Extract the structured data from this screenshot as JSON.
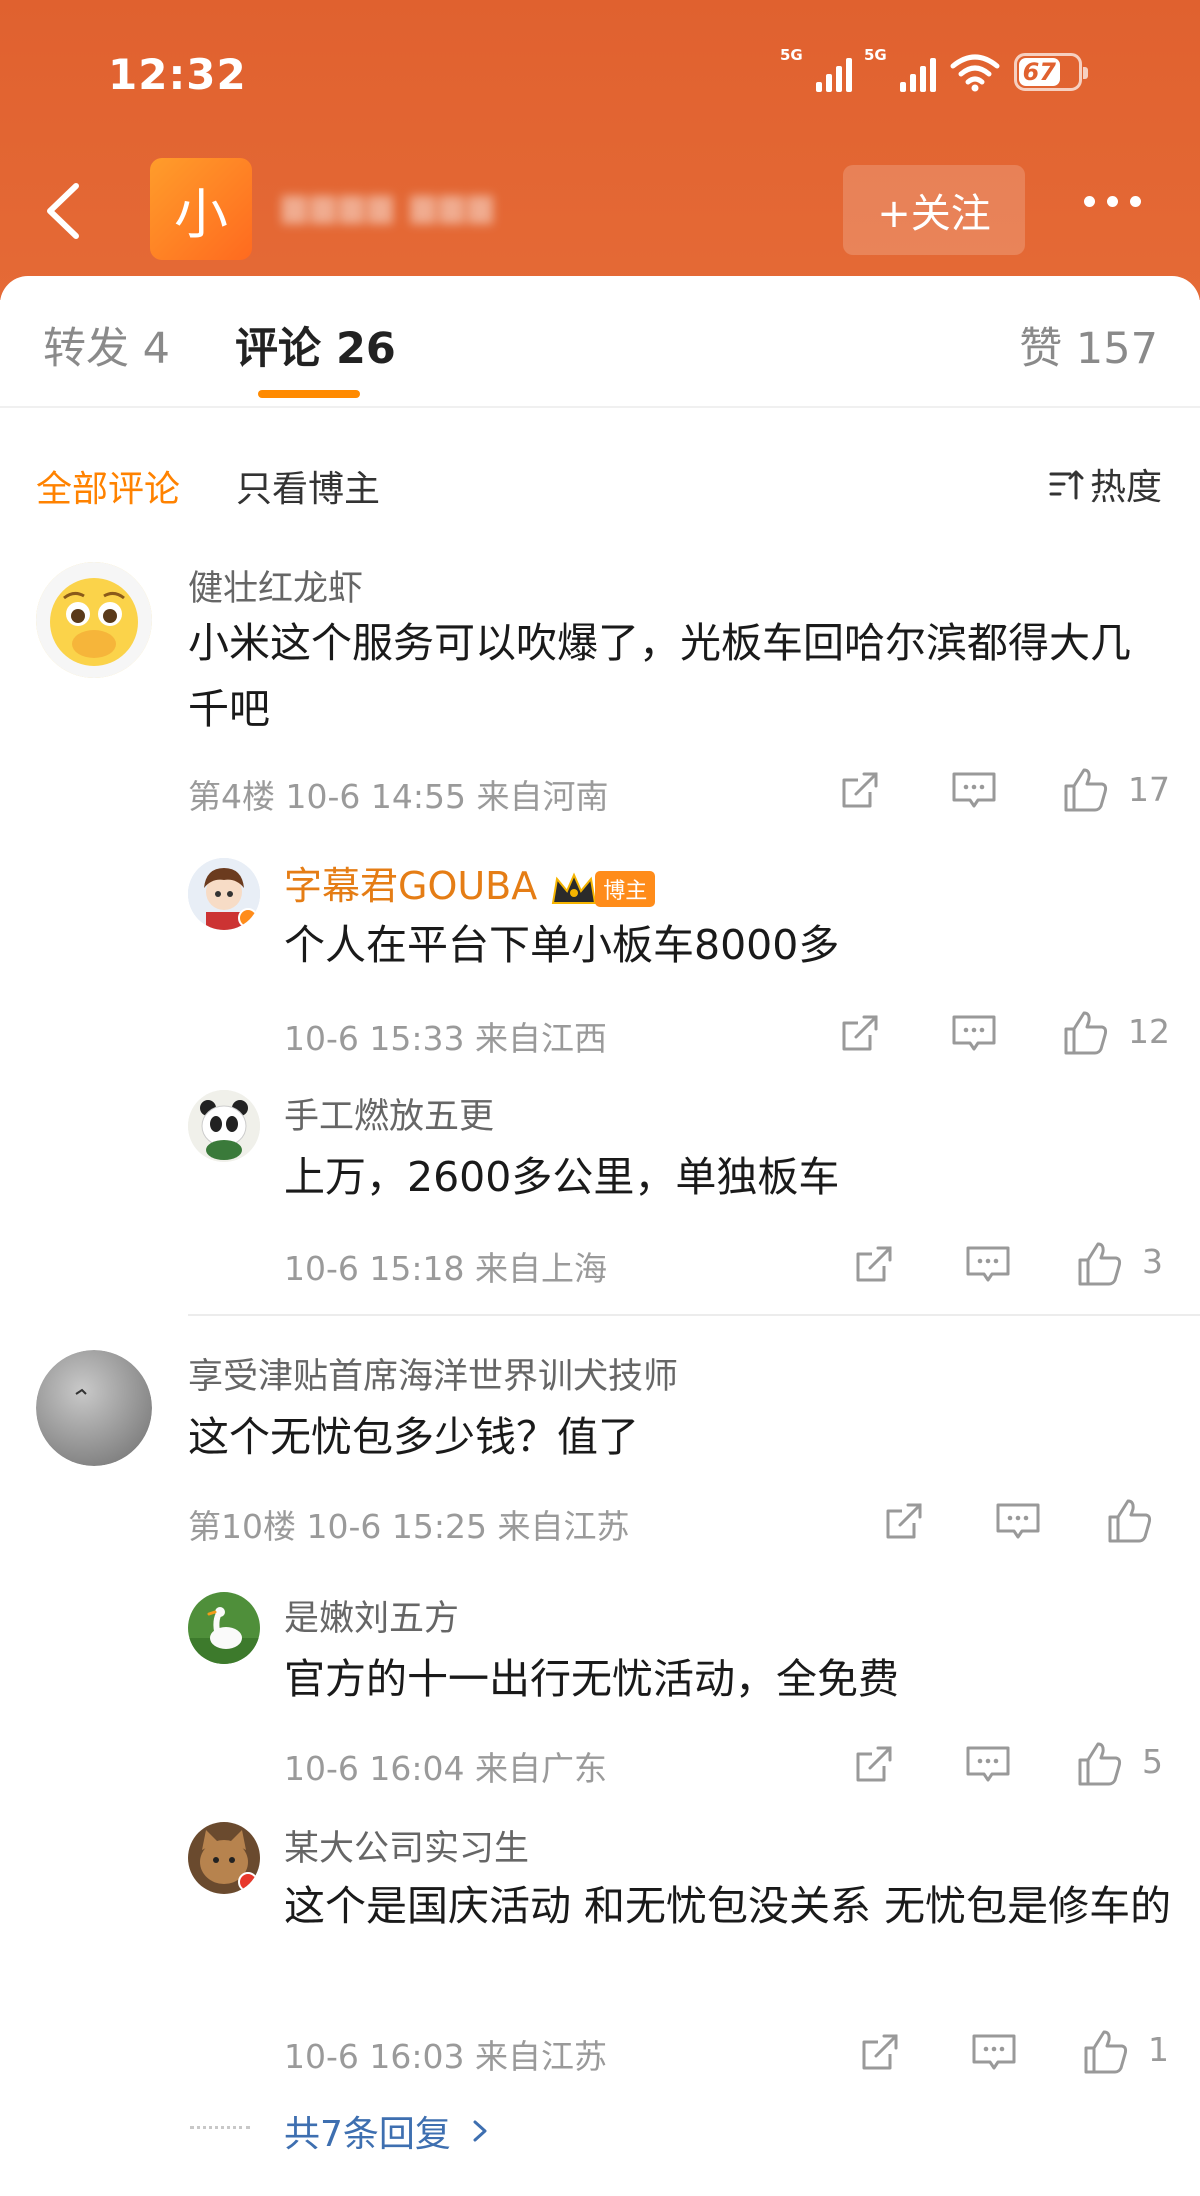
{
  "status_bar": {
    "time": "12:32",
    "sim1": "5G",
    "sim2": "5G",
    "battery": "67"
  },
  "header": {
    "avatar_char": "小",
    "follow_label": "+关注"
  },
  "tabs": {
    "repost": "转发 4",
    "comment": "评论 26",
    "likes": "赞 157"
  },
  "filter": {
    "all": "全部评论",
    "owner_only": "只看博主",
    "sort": "热度"
  },
  "comments": [
    {
      "user": "健壮红龙虾",
      "text": "小米这个服务可以吹爆了，光板车回哈尔滨都得大几千吧",
      "meta": "第4楼 10-6 14:55 来自河南",
      "likes": "17",
      "replies": [
        {
          "user": "字幕君GOUBA",
          "badge": "博主",
          "text": "个人在平台下单小板车8000多",
          "meta": "10-6 15:33 来自江西",
          "likes": "12"
        },
        {
          "user": "手工燃放五更",
          "text": "上万，2600多公里，单独板车",
          "meta": "10-6 15:18 来自上海",
          "likes": "3"
        }
      ]
    },
    {
      "user": "享受津贴首席海洋世界训犬技师",
      "text": "这个无忧包多少钱？值了",
      "meta": "第10楼 10-6 15:25 来自江苏",
      "likes": "",
      "replies": [
        {
          "user": "是嫩刘五方",
          "text": "官方的十一出行无忧活动，全免费",
          "meta": "10-6 16:04 来自广东",
          "likes": "5"
        },
        {
          "user": "某大公司实习生",
          "text": "这个是国庆活动 和无忧包没关系 无忧包是修车的",
          "meta": "10-6 16:03 来自江苏",
          "likes": "1"
        }
      ],
      "more_replies": "共7条回复"
    }
  ],
  "colors": {
    "header": "#e0612f",
    "accent": "#ff8200",
    "link": "#3e6fb0"
  }
}
